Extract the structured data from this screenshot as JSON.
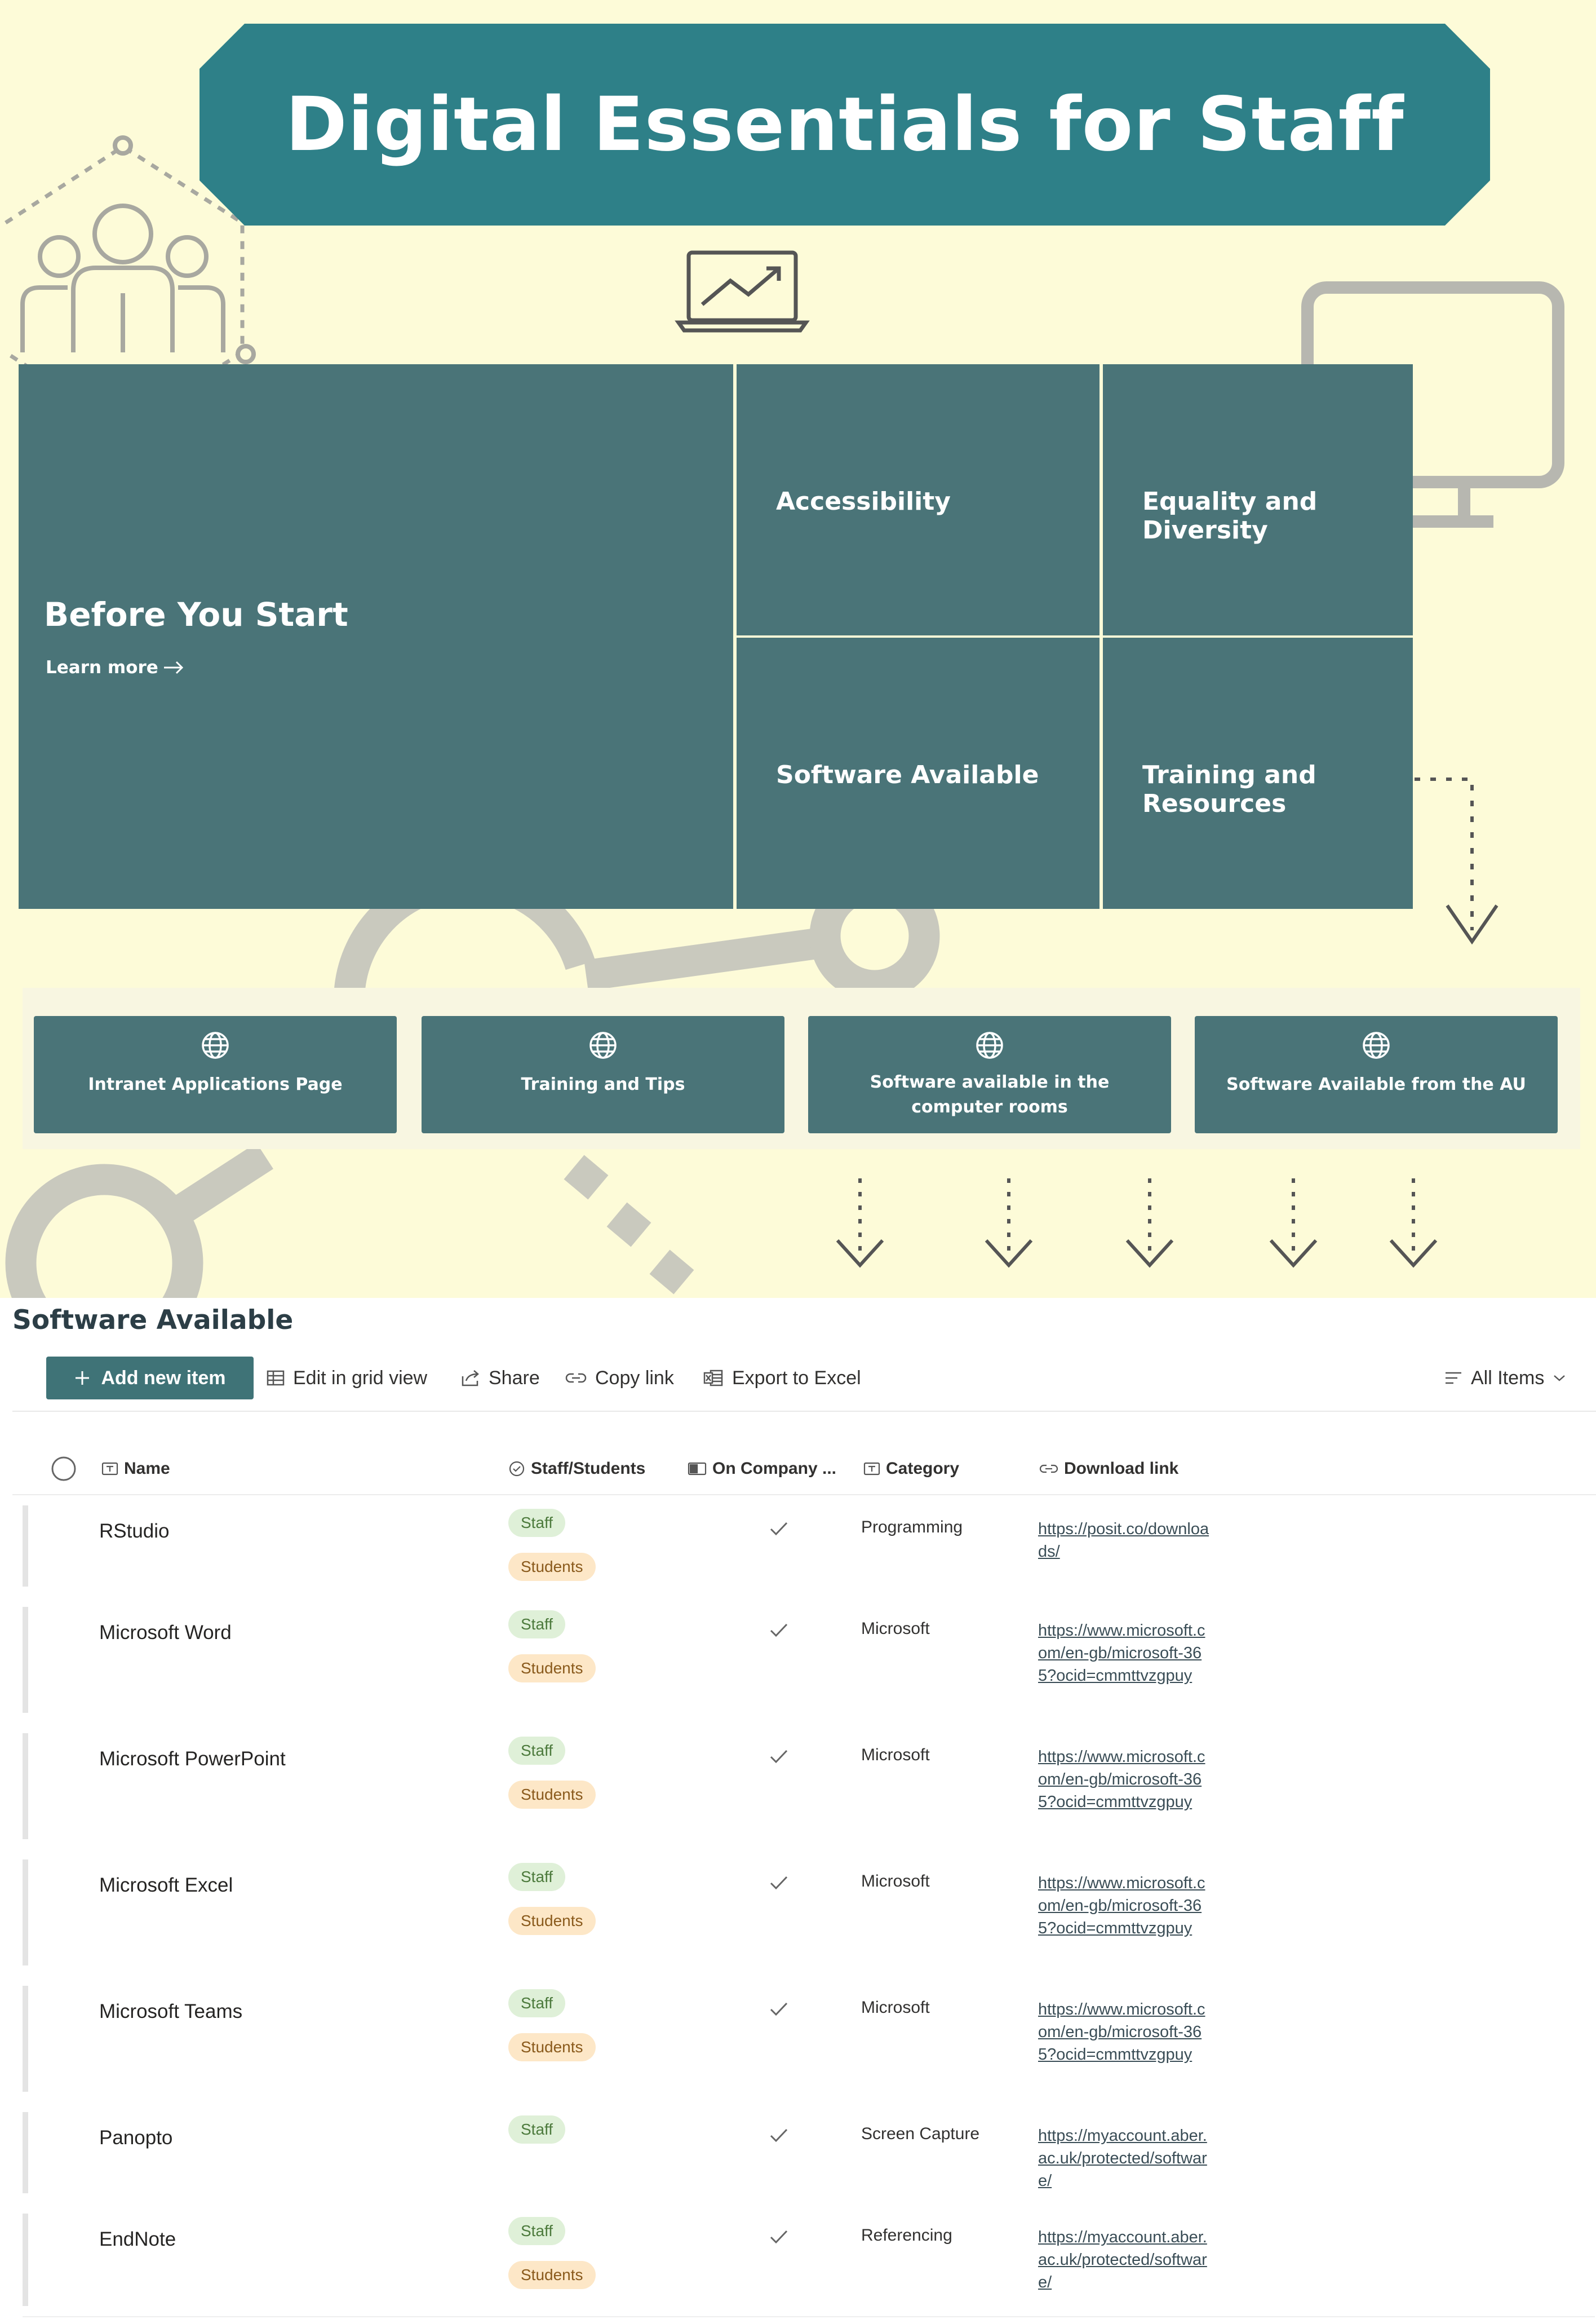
{
  "banner": {
    "title": "Digital Essentials for Staff"
  },
  "hero": {
    "main": {
      "title": "Before You Start",
      "link": "Learn more"
    },
    "tiles": [
      "Accessibility",
      "Equality and Diversity",
      "Software Available",
      "Training and Resources"
    ]
  },
  "quick_links": [
    "Intranet Applications Page",
    "Training and Tips",
    "Software available in the computer rooms",
    "Software Available from the AU"
  ],
  "list": {
    "title": "Software Available",
    "commands": {
      "add": "Add new item",
      "grid": "Edit in grid view",
      "share": "Share",
      "copy": "Copy link",
      "export": "Export to Excel",
      "view": "All Items"
    },
    "columns": [
      "Name",
      "Staff/Students",
      "On Company ...",
      "Category",
      "Download link"
    ],
    "rows": [
      {
        "name": "RStudio",
        "tags": [
          "Staff",
          "Students"
        ],
        "company": true,
        "category": "Programming",
        "link": "https://posit.co/downloads/"
      },
      {
        "name": "Microsoft Word",
        "tags": [
          "Staff",
          "Students"
        ],
        "company": true,
        "category": "Microsoft",
        "link": "https://www.microsoft.com/en-gb/microsoft-365?ocid=cmmttvzgpuy"
      },
      {
        "name": "Microsoft PowerPoint",
        "tags": [
          "Staff",
          "Students"
        ],
        "company": true,
        "category": "Microsoft",
        "link": "https://www.microsoft.com/en-gb/microsoft-365?ocid=cmmttvzgpuy"
      },
      {
        "name": "Microsoft Excel",
        "tags": [
          "Staff",
          "Students"
        ],
        "company": true,
        "category": "Microsoft",
        "link": "https://www.microsoft.com/en-gb/microsoft-365?ocid=cmmttvzgpuy"
      },
      {
        "name": "Microsoft Teams",
        "tags": [
          "Staff",
          "Students"
        ],
        "company": true,
        "category": "Microsoft",
        "link": "https://www.microsoft.com/en-gb/microsoft-365?ocid=cmmttvzgpuy"
      },
      {
        "name": "Panopto",
        "tags": [
          "Staff"
        ],
        "company": true,
        "category": "Screen Capture",
        "link": "https://myaccount.aber.ac.uk/protected/software/"
      },
      {
        "name": "EndNote",
        "tags": [
          "Staff",
          "Students"
        ],
        "company": true,
        "category": "Referencing",
        "link": "https://myaccount.aber.ac.uk/protected/software/"
      }
    ]
  }
}
